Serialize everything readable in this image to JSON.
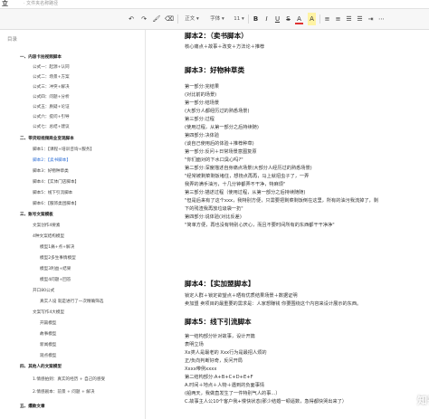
{
  "topbar": {
    "brand": "立",
    "path": "· 文件夹名称路径"
  },
  "toolbar": {
    "undo_icon": "↶",
    "redo_icon": "↷",
    "format_icon": "🖌",
    "clear_icon": "⌫",
    "style_select": "正文 ▾",
    "font_select": "字体 ▾",
    "size_select": "11 ▾",
    "bold": "B",
    "italic": "I",
    "underline": "U",
    "strike": "S",
    "color": "A",
    "highlight": "A",
    "align_left": "≡",
    "align_center": "≡",
    "list_ordered": "☰",
    "list_bullet": "☰",
    "indent": "⇥",
    "more": "⋯"
  },
  "sidebar": {
    "title": "目录",
    "items": [
      "一、内容卡拍视频脚本",
      "公式一：起源+认同",
      "公式二：场景+方案",
      "公式三：冲突+解决",
      "公式四：问题+分析",
      "公式五：质疑+论证",
      "公式六：提问+引导",
      "公式七：总结+建议",
      "二、带货短视频商业变现脚本",
      "脚本1：【课程+培训咨询+服务】",
      "脚本2：【卖书脚本】",
      "脚本3：好物种草类",
      "脚本4：【实体门店脚本】",
      "脚本5：线下引流脚本",
      "脚本6：【服饰类团脚本】",
      "三、账号文案模板",
      "文案创作4要素",
      "4种文案结构模型",
      "模型1痛+点+解决",
      "模型2多生事情模型",
      "模型3利益+结果",
      "模型4问题+回答",
      "开口80公式",
      "真实人设 就是进行了一次精确筛选",
      "文案写作4大模型",
      "开篇模型",
      "故事模型",
      "新闻模型",
      "观点模型",
      "四、其他人的文案模型",
      "1.情感拍到：真实的经历 + 自己的感受",
      "2.情感剧本：前景 + 问题 + 解决",
      "五、爆款文章"
    ]
  },
  "doc": {
    "lines": [
      "脚本2：（卖书脚本）",
      "核心痛点＋故事＋改变＋方法论＋推荐",
      "脚本3：好物种草类",
      "第一部分:完结果",
      "(对比前的场景)",
      "第一部分:结场景",
      "(大部分人都经历过的熟悉场景)",
      "第三部分:过程",
      "(使用过程，从第一部分之后持续随)",
      "第四部分:决体验",
      "(谈自己使用后的体验＋推荐种草)",
      "第一部分:反问＋日常场景意图复原",
      "\"你们面对的下水口臭心吗?\"",
      "第二部分:深度描述自身痛点场景(大部分人经历过的熟悉场景)",
      "\"经常被剩菜剩饭堵住，想挠点再再，马上就招虫子了，一弄",
      "我弄的满手油污，十几分钟都弄不干净，特麻烦\"",
      "第三部分:描述过程（使用过程，从第一部分之后持续随随)",
      "\"但是后来有了这个xxx，我特别方便，只需要把剩菜剩饭倒在这里，所有的油污我流掉了，剩",
      "下的残渣我再放垃圾袋一扔\"",
      "第四部分:说体验(对比反差)",
      "\"简单方便，再也没有特别心厌心，而且不要时间所有的东西都干干净净\"",
      "脚本4：【实加盟脚本】",
      "锁定人群＋锁定欲望点＋晒有优质结果场景＋数据证明",
      "卖加盟 卖项目的最重要的需求是：人家想赚钱 你要围绕这个内容来设计展示的东西。",
      "脚本5：线下引流脚本",
      "第一结构部分针对故事，设计开篇",
      "表明立场",
      "Xx类人是最老的  Xxx行为是最招人烦的",
      "正/负向判断好奇，反问开局",
      "Xxxx带例xxxx",
      "第二结构部分:A+B+C+D+E+F",
      "A.时间＋地点＋人物＋遇到的负面事情",
      "(船两天，我做直发生了一件特别气人的事...）",
      "C.故事主人公10个客户我+慢快状态(那少结婚一顿逼数，急得都快哭出来了）"
    ]
  },
  "watermark": "知乎 @电商直播小鱼"
}
